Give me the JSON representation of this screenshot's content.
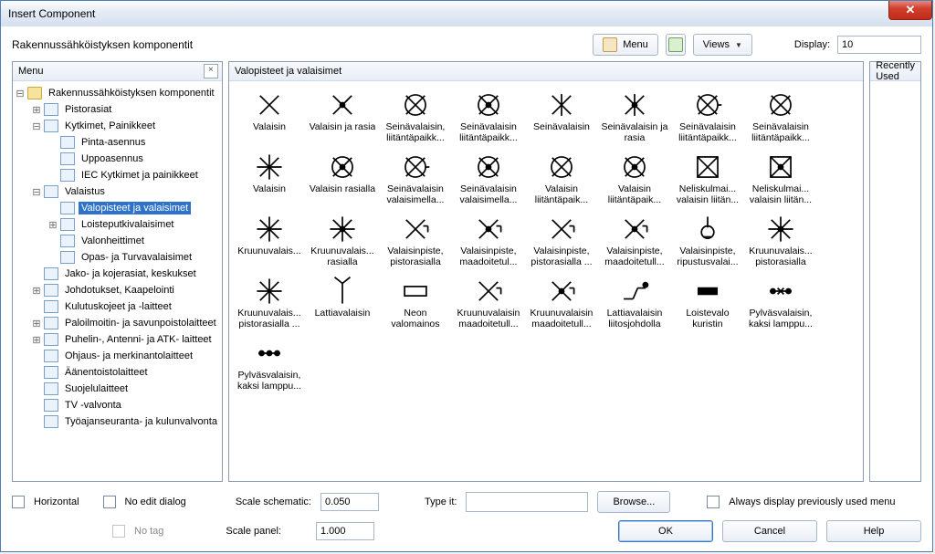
{
  "window": {
    "title": "Insert Component"
  },
  "top": {
    "category": "Rakennussähköistyksen komponentit",
    "menu_btn": "Menu",
    "views_btn": "Views",
    "display_lbl": "Display:",
    "display_val": "10"
  },
  "tree": {
    "header": "Menu",
    "items": [
      {
        "lv": 0,
        "exp": "-",
        "icon": "folder",
        "label": "Rakennussähköistyksen komponentit"
      },
      {
        "lv": 1,
        "exp": "+",
        "icon": "item",
        "label": "Pistorasiat"
      },
      {
        "lv": 1,
        "exp": "-",
        "icon": "item",
        "label": "Kytkimet, Painikkeet"
      },
      {
        "lv": 2,
        "exp": "",
        "icon": "item",
        "label": "Pinta-asennus"
      },
      {
        "lv": 2,
        "exp": "",
        "icon": "item",
        "label": "Uppoasennus"
      },
      {
        "lv": 2,
        "exp": "",
        "icon": "item",
        "label": "IEC Kytkimet ja painikkeet"
      },
      {
        "lv": 1,
        "exp": "-",
        "icon": "item",
        "label": "Valaistus"
      },
      {
        "lv": 2,
        "exp": "",
        "icon": "item",
        "label": "Valopisteet ja valaisimet",
        "selected": true
      },
      {
        "lv": 2,
        "exp": "+",
        "icon": "item",
        "label": "Loisteputkivalaisimet"
      },
      {
        "lv": 2,
        "exp": "",
        "icon": "item",
        "label": "Valonheittimet"
      },
      {
        "lv": 2,
        "exp": "",
        "icon": "item",
        "label": "Opas- ja Turvavalaisimet"
      },
      {
        "lv": 1,
        "exp": "",
        "icon": "item",
        "label": "Jako- ja kojerasiat, keskukset"
      },
      {
        "lv": 1,
        "exp": "+",
        "icon": "item",
        "label": "Johdotukset, Kaapelointi"
      },
      {
        "lv": 1,
        "exp": "",
        "icon": "item",
        "label": "Kulutuskojeet ja -laitteet"
      },
      {
        "lv": 1,
        "exp": "+",
        "icon": "item",
        "label": "Paloilmoitin- ja savunpoistolaitteet"
      },
      {
        "lv": 1,
        "exp": "+",
        "icon": "item",
        "label": "Puhelin-, Antenni- ja ATK- laitteet"
      },
      {
        "lv": 1,
        "exp": "",
        "icon": "item",
        "label": "Ohjaus- ja merkinantolaitteet"
      },
      {
        "lv": 1,
        "exp": "",
        "icon": "item",
        "label": "Äänentoistolaitteet"
      },
      {
        "lv": 1,
        "exp": "",
        "icon": "item",
        "label": "Suojelulaitteet"
      },
      {
        "lv": 1,
        "exp": "",
        "icon": "item",
        "label": "TV -valvonta"
      },
      {
        "lv": 1,
        "exp": "",
        "icon": "item",
        "label": "Työajanseuranta- ja kulunvalvonta"
      }
    ]
  },
  "grid": {
    "header": "Valopisteet ja valaisimet",
    "cells": [
      {
        "sym": "x",
        "cap": "Valaisin"
      },
      {
        "sym": "xdot",
        "cap": "Valaisin ja rasia"
      },
      {
        "sym": "xcirc",
        "cap": "Seinävalaisin, liitäntäpaikk..."
      },
      {
        "sym": "xcircd",
        "cap": "Seinävalaisin liitäntäpaikk..."
      },
      {
        "sym": "xl",
        "cap": "Seinävalaisin"
      },
      {
        "sym": "xldot",
        "cap": "Seinävalaisin ja rasia"
      },
      {
        "sym": "xcirc2",
        "cap": "Seinävalaisin liitäntäpaikk..."
      },
      {
        "sym": "xcirc",
        "cap": "Seinävalaisin liitäntäpaikk..."
      },
      {
        "sym": "xcross",
        "cap": "Valaisin"
      },
      {
        "sym": "xcircd",
        "cap": "Valaisin rasialla"
      },
      {
        "sym": "xcirc2",
        "cap": "Seinävalaisin valaisimella..."
      },
      {
        "sym": "xcircd",
        "cap": "Seinävalaisin valaisimella..."
      },
      {
        "sym": "xcirc",
        "cap": "Valaisin liitäntäpaik..."
      },
      {
        "sym": "xcircd",
        "cap": "Valaisin liitäntäpaik..."
      },
      {
        "sym": "box",
        "cap": "Neliskulmai... valaisin liitän..."
      },
      {
        "sym": "boxd",
        "cap": "Neliskulmai... valaisin liitän..."
      },
      {
        "sym": "xcross",
        "cap": "Kruunuvalais..."
      },
      {
        "sym": "xcrossd",
        "cap": "Kruunuvalais... rasialla"
      },
      {
        "sym": "xtick",
        "cap": "Valaisinpiste, pistorasialla"
      },
      {
        "sym": "xtickd",
        "cap": "Valaisinpiste, maadoitetul..."
      },
      {
        "sym": "xtick",
        "cap": "Valaisinpiste, pistorasialla ..."
      },
      {
        "sym": "xtickd",
        "cap": "Valaisinpiste, maadoitetull..."
      },
      {
        "sym": "hang",
        "cap": "Valaisinpiste, ripustusvalai..."
      },
      {
        "sym": "xcrossd",
        "cap": "Kruunuvalais... pistorasialla"
      },
      {
        "sym": "xcross",
        "cap": "Kruunuvalais... pistorasialla ..."
      },
      {
        "sym": "antenna",
        "cap": "Lattiavalaisin"
      },
      {
        "sym": "neon",
        "cap": "Neon valomainos"
      },
      {
        "sym": "xtick",
        "cap": "Kruunuvalaisin maadoitetull..."
      },
      {
        "sym": "xtickd",
        "cap": "Kruunuvalaisin maadoitetull..."
      },
      {
        "sym": "lead",
        "cap": "Lattiavalaisin liitosjohdolla"
      },
      {
        "sym": "rect",
        "cap": "Loistevalo kuristin"
      },
      {
        "sym": "poles",
        "cap": "Pylväsvalaisin, kaksi lamppu..."
      },
      {
        "sym": "poles2",
        "cap": "Pylväsvalaisin, kaksi lamppu..."
      }
    ]
  },
  "right": {
    "header": "Recently Used"
  },
  "bottom": {
    "horizontal": "Horizontal",
    "noedit": "No edit dialog",
    "notag": "No tag",
    "scale_schem_lbl": "Scale schematic:",
    "scale_schem_val": "0.050",
    "scale_panel_lbl": "Scale panel:",
    "scale_panel_val": "1.000",
    "typeit_lbl": "Type it:",
    "browse": "Browse...",
    "always": "Always display previously used menu",
    "ok": "OK",
    "cancel": "Cancel",
    "help": "Help"
  }
}
